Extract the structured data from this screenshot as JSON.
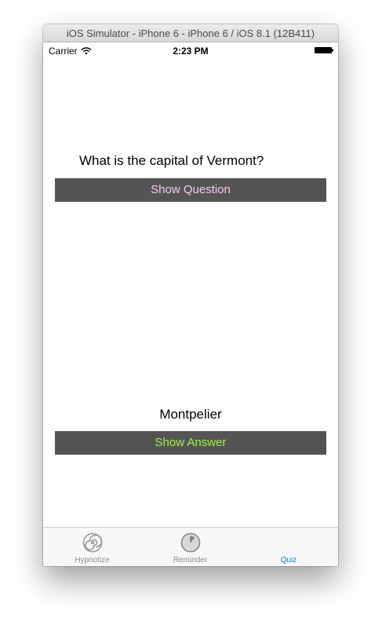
{
  "window": {
    "title": "iOS Simulator - iPhone 6 - iPhone 6 / iOS 8.1 (12B411)"
  },
  "status_bar": {
    "carrier": "Carrier",
    "time": "2:23 PM",
    "wifi_icon": "wifi-icon",
    "battery_icon": "battery-icon"
  },
  "quiz": {
    "question": "What is the capital of Vermont?",
    "show_question_label": "Show Question",
    "answer": "Montpelier",
    "show_answer_label": "Show Answer",
    "colors": {
      "button_background": "#545454",
      "show_question_text": "#f3c9f3",
      "show_answer_text": "#a5ec4a"
    }
  },
  "tab_bar": {
    "items": [
      {
        "label": "Hypnotize",
        "icon": "spiral-icon",
        "selected": false
      },
      {
        "label": "Reminder",
        "icon": "clock-icon",
        "selected": false
      },
      {
        "label": "Quiz",
        "icon": "",
        "selected": true
      }
    ],
    "colors": {
      "inactive": "#8e8e8e",
      "active": "#1a7ef0"
    }
  }
}
